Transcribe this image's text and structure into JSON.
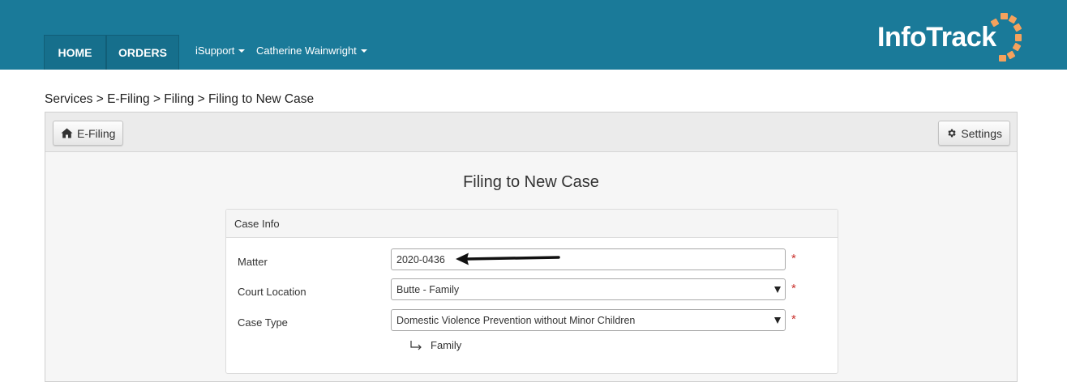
{
  "nav": {
    "home": "HOME",
    "orders": "ORDERS",
    "support": "iSupport",
    "user": "Catherine Wainwright"
  },
  "logo": {
    "text": "InfoTrack"
  },
  "breadcrumb": "Services > E-Filing > Filing > Filing to New Case",
  "toolbar": {
    "efiling_label": "E-Filing",
    "settings_label": "Settings"
  },
  "page": {
    "title": "Filing to New Case"
  },
  "case_info": {
    "header": "Case Info",
    "matter": {
      "label": "Matter",
      "value": "2020-0436"
    },
    "court_location": {
      "label": "Court Location",
      "value": "Butte - Family"
    },
    "case_type": {
      "label": "Case Type",
      "value": "Domestic Violence Prevention without Minor Children"
    },
    "sub_category": "Family",
    "required_mark": "*"
  },
  "colors": {
    "header_bg": "#1a7a99",
    "logo_accent": "#f5a25d",
    "required": "#c9302c"
  }
}
